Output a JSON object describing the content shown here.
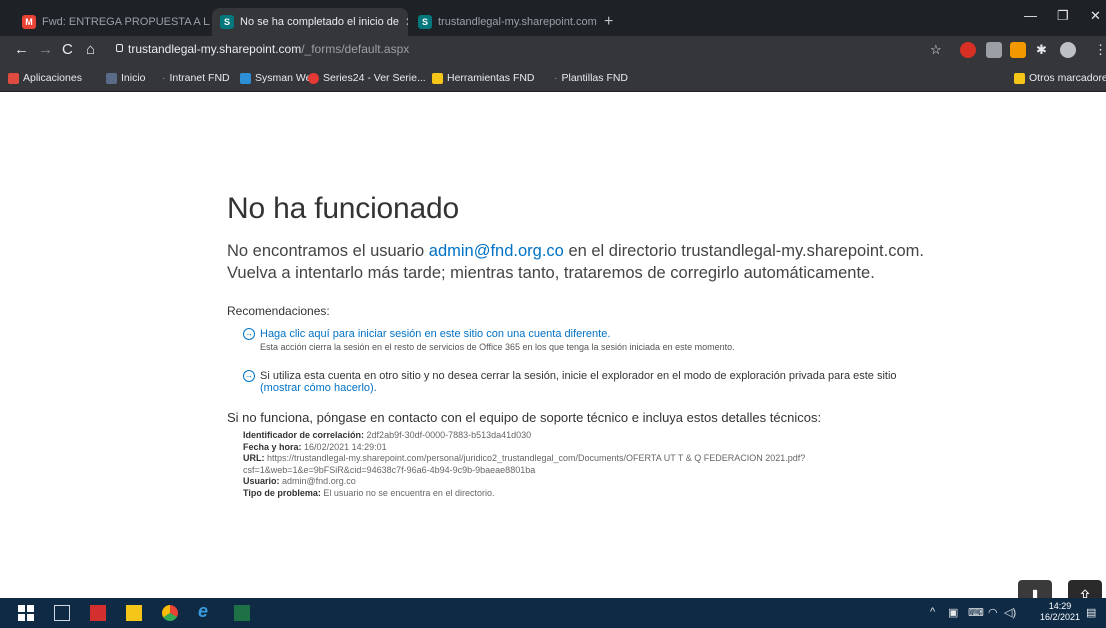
{
  "browser": {
    "tabs": [
      {
        "title": "Fwd: ENTREGA PROPUESTA A LA",
        "favicon": "gmail-icon",
        "active": false
      },
      {
        "title": "No se ha completado el inicio de",
        "favicon": "sharepoint-icon",
        "active": true
      },
      {
        "title": "trustandlegal-my.sharepoint.com",
        "favicon": "sharepoint-icon",
        "active": false
      }
    ],
    "new_tab": "+",
    "window_controls": {
      "minimize": "—",
      "maximize": "❐",
      "close": "✕"
    },
    "address": {
      "host": "trustandlegal-my.sharepoint.com",
      "path": "/_forms/default.aspx"
    },
    "bookmarks": [
      {
        "label": "Aplicaciones",
        "icon": "apps-grid-icon",
        "color": "#e04a3f"
      },
      {
        "label": "Inicio",
        "icon": "fnd-logo-icon",
        "color": "#5a6b8a"
      },
      {
        "label": "Intranet FND",
        "icon": "globe-icon",
        "color": "#9aa0a6"
      },
      {
        "label": "Sysman Web",
        "icon": "sysman-icon",
        "color": "#2d8fd5"
      },
      {
        "label": "Series24 - Ver Serie...",
        "icon": "play-icon",
        "color": "#e53935"
      },
      {
        "label": "Herramientas FND",
        "icon": "folder-icon",
        "color": "#f5c518"
      },
      {
        "label": "Plantillas FND",
        "icon": "globe-icon",
        "color": "#9aa0a6"
      }
    ],
    "other_bookmarks": "Otros marcadores"
  },
  "page": {
    "title": "No ha funcionado",
    "message_prefix": "No encontramos el usuario ",
    "message_user": "admin@fnd.org.co",
    "message_suffix": " en el directorio trustandlegal-my.sharepoint.com.",
    "message_line2": "Vuelva a intentarlo más tarde; mientras tanto, trataremos de corregirlo automáticamente.",
    "recommendations_title": "Recomendaciones:",
    "rec1_link": "Haga clic aquí para iniciar sesión en este sitio con una cuenta diferente.",
    "rec1_sub": "Esta acción cierra la sesión en el resto de servicios de Office 365 en los que tenga la sesión iniciada en este momento.",
    "rec2_text": "Si utiliza esta cuenta en otro sitio y no desea cerrar la sesión, inicie el explorador en el modo de exploración privada para este sitio",
    "rec2_link": "(mostrar cómo hacerlo).",
    "support_text": "Si no funciona, póngase en contacto con el equipo de soporte técnico e incluya estos detalles técnicos:",
    "details": {
      "correlation_label": "Identificador de correlación:",
      "correlation_value": "2df2ab9f-30df-0000-7883-b513da41d030",
      "datetime_label": "Fecha y hora:",
      "datetime_value": "16/02/2021 14:29:01",
      "url_label": "URL:",
      "url_value": "https://trustandlegal-my.sharepoint.com/personal/juridico2_trustandlegal_com/Documents/OFERTA UT T & Q FEDERACION 2021.pdf?",
      "url_value2": "csf=1&web=1&e=9bFSiR&cid=94638c7f-96a6-4b94-9c9b-9baeae8801ba",
      "user_label": "Usuario:",
      "user_value": "admin@fnd.org.co",
      "problem_label": "Tipo de problema:",
      "problem_value": "El usuario no se encuentra en el directorio."
    }
  },
  "taskbar": {
    "time": "14:29",
    "date": "16/2/2021"
  }
}
